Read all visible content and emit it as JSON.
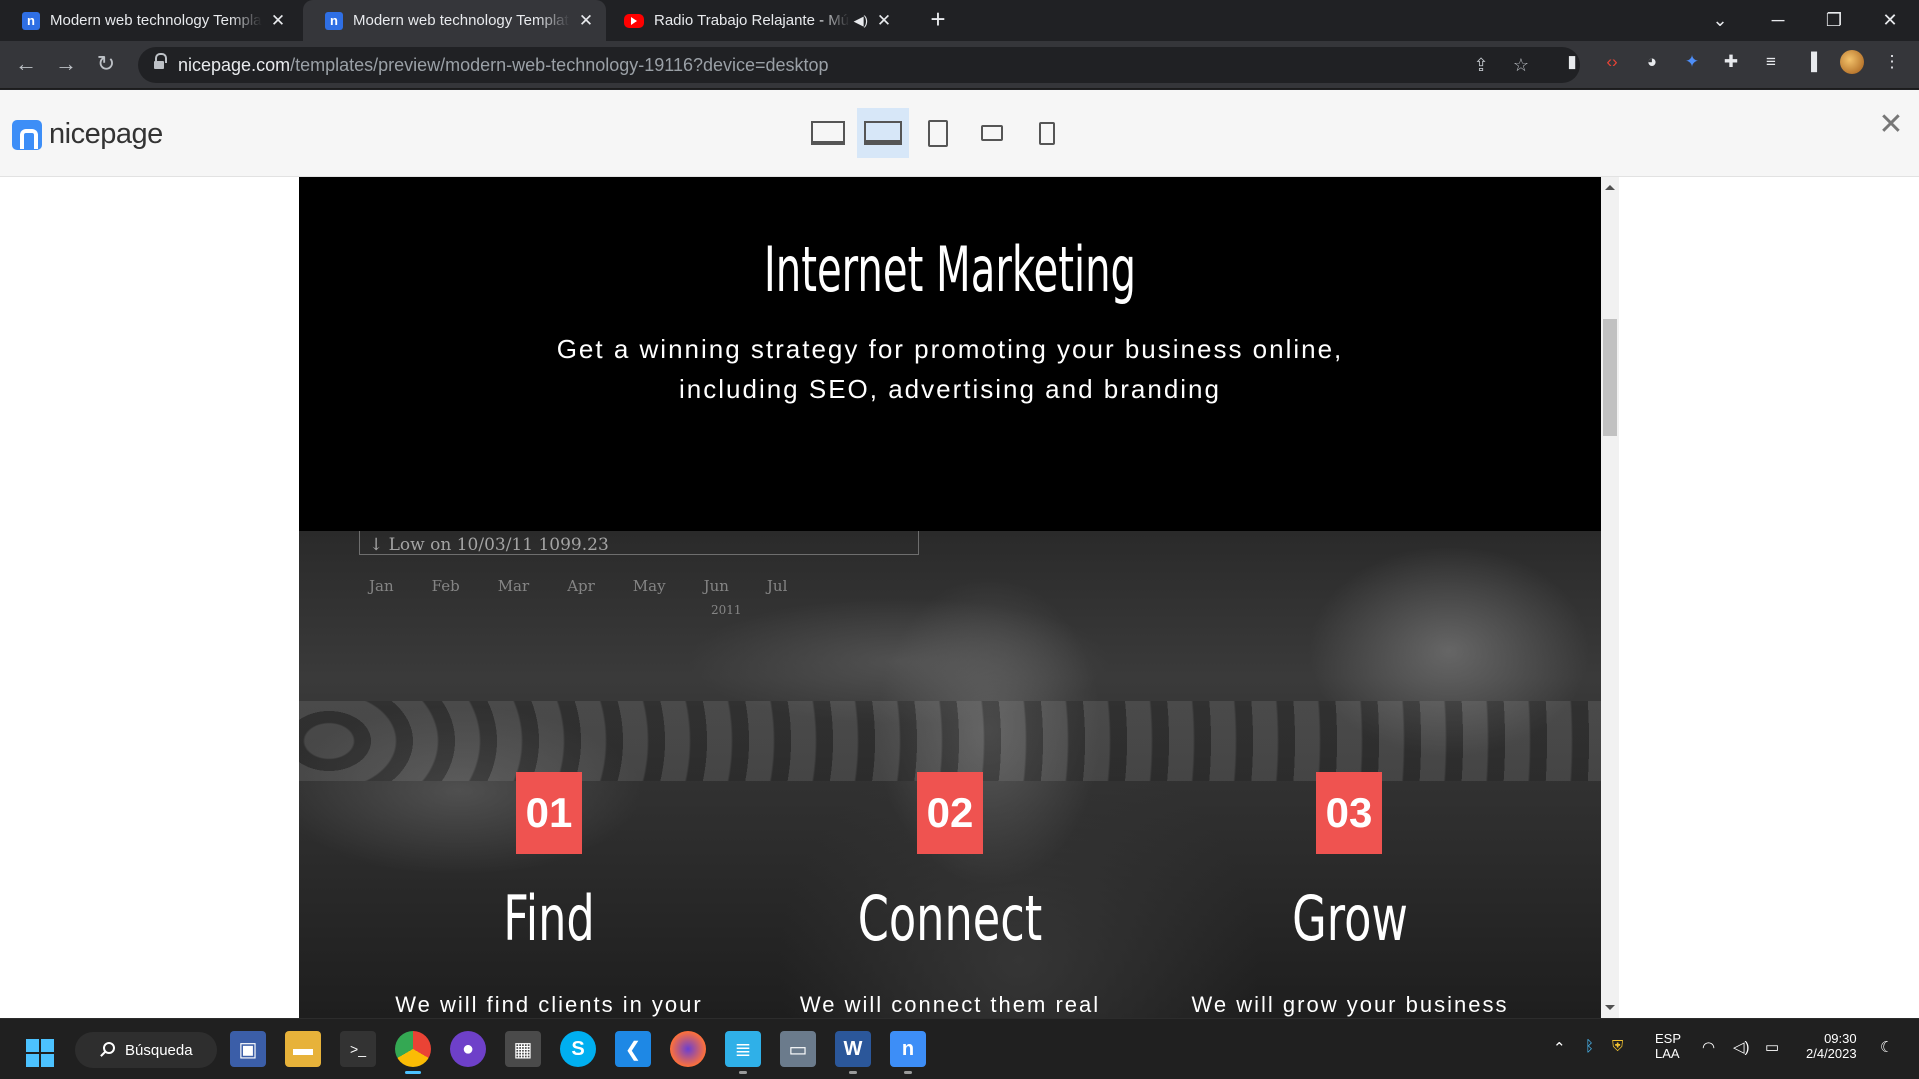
{
  "browser": {
    "tabs": [
      {
        "title": "Modern web technology Templat",
        "favicon": "nicepage-favicon",
        "active": false
      },
      {
        "title": "Modern web technology Templat",
        "favicon": "nicepage-favicon",
        "active": true
      },
      {
        "title": "Radio Trabajo Relajante - Mú",
        "favicon": "youtube-favicon",
        "active": false
      }
    ],
    "url_host": "nicepage.com",
    "url_path": "/templates/preview/modern-web-technology-19116?device=desktop"
  },
  "nicepage": {
    "logo_text": "nicepage",
    "devices": [
      "desktop",
      "laptop",
      "tablet",
      "tablet-landscape",
      "phone"
    ],
    "selected_device": "laptop"
  },
  "page": {
    "title": "Internet Marketing",
    "subtitle_line1": "Get a winning strategy for promoting your business online,",
    "subtitle_line2": "including SEO, advertising and branding",
    "photo_text": {
      "caption": "↓ Low on 10/03/11  1099.23",
      "months": [
        "Jan",
        "Feb",
        "Mar",
        "Apr",
        "May",
        "Jun",
        "Jul"
      ],
      "year": "2011"
    },
    "steps": [
      {
        "number": "01",
        "name": "Find",
        "desc": "We will find clients in your"
      },
      {
        "number": "02",
        "name": "Connect",
        "desc": "We will connect them real"
      },
      {
        "number": "03",
        "name": "Grow",
        "desc": "We will grow your business"
      }
    ]
  },
  "taskbar": {
    "search_label": "Búsqueda",
    "lang_top": "ESP",
    "lang_bottom": "LAA",
    "time": "09:30",
    "date": "2/4/2023"
  },
  "colors": {
    "accent_red": "#ef5350",
    "nicepage_blue": "#3d8ef7",
    "windows_blue": "#4cc2ff"
  }
}
